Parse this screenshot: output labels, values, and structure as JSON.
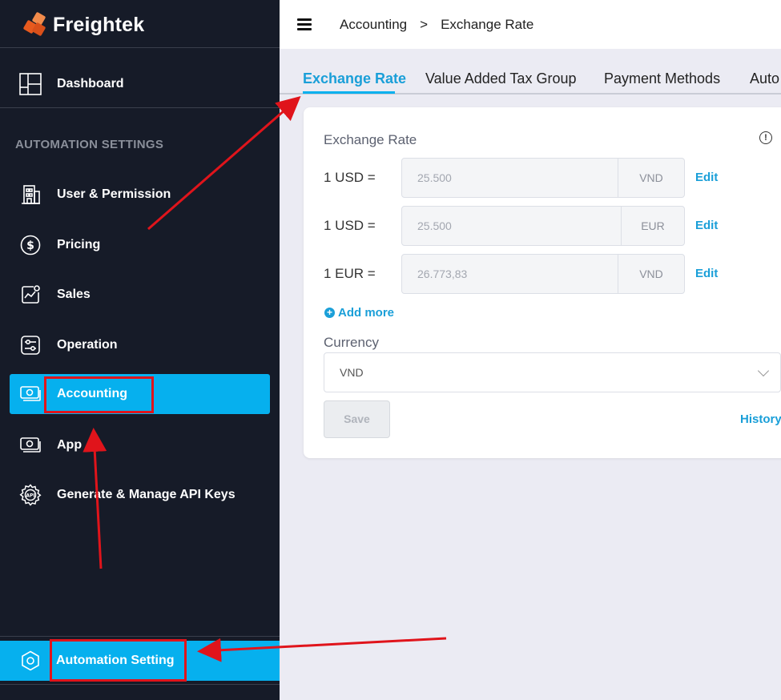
{
  "brand": {
    "name": "Freightek"
  },
  "sidebar": {
    "dashboard": {
      "label": "Dashboard",
      "icon": "dashboard-icon"
    },
    "section_title": "AUTOMATION SETTINGS",
    "items": [
      {
        "label": "User & Permission",
        "icon": "building-icon"
      },
      {
        "label": "Pricing",
        "icon": "dollar-icon"
      },
      {
        "label": "Sales",
        "icon": "chart-icon"
      },
      {
        "label": "Operation",
        "icon": "sliders-icon"
      },
      {
        "label": "Accounting",
        "icon": "money-icon",
        "active": true
      },
      {
        "label": "App",
        "icon": "money-icon"
      },
      {
        "label": "Generate & Manage API Keys",
        "icon": "api-gear-icon"
      }
    ],
    "bottom": {
      "label": "Automation Setting",
      "icon": "hexagon-settings-icon"
    }
  },
  "topbar": {
    "breadcrumb": [
      "Accounting",
      "Exchange Rate"
    ],
    "separator": ">"
  },
  "tabs": [
    "Exchange Rate",
    "Value Added Tax Group",
    "Payment Methods",
    "Auto"
  ],
  "card": {
    "title": "Exchange Rate",
    "rates": [
      {
        "label": "1 USD =",
        "value": "25.500",
        "currency": "VND",
        "action": "Edit"
      },
      {
        "label": "1 USD =",
        "value": "25.500",
        "currency": "EUR",
        "action": "Edit"
      },
      {
        "label": "1 EUR =",
        "value": "26.773,83",
        "currency": "VND",
        "action": "Edit"
      }
    ],
    "add_more": "Add more",
    "currency_label": "Currency",
    "currency_value": "VND",
    "save_label": "Save",
    "history_label": "History"
  },
  "colors": {
    "sidebar_bg": "#161b28",
    "accent": "#06b0ee",
    "link": "#1a9fd8",
    "annotation": "#e0141b",
    "brand": "#ef6a2e"
  }
}
